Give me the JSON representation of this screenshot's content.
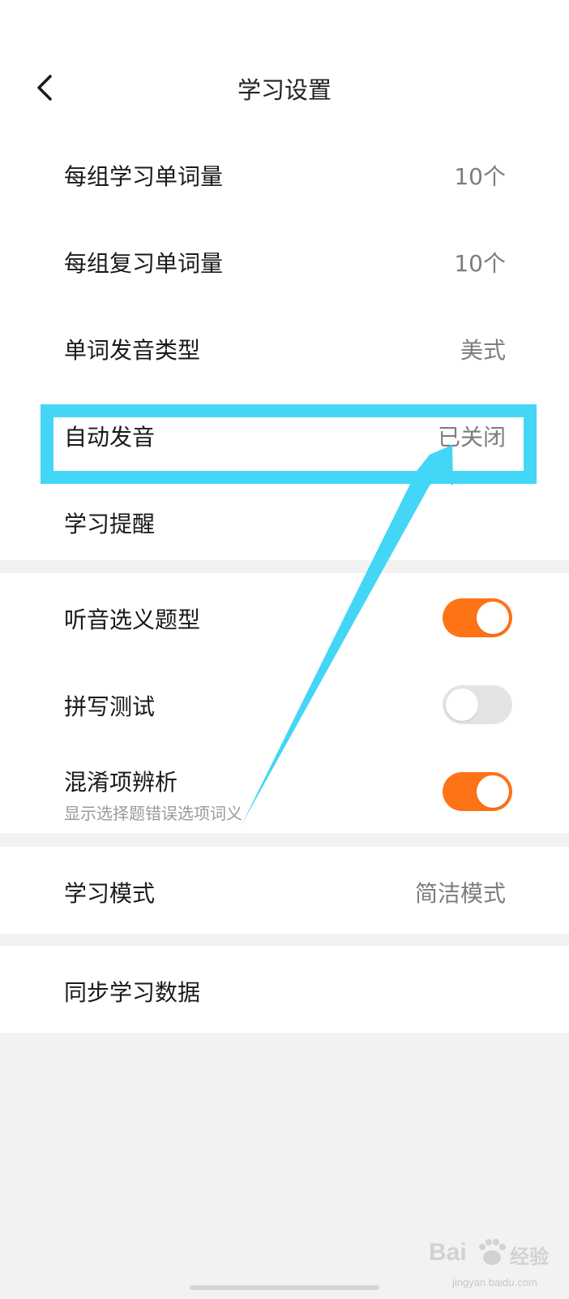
{
  "header": {
    "title": "学习设置",
    "back_icon": "chevron-left-icon"
  },
  "settings_group_1": [
    {
      "label": "每组学习单词量",
      "value": "10个"
    },
    {
      "label": "每组复习单词量",
      "value": "10个"
    },
    {
      "label": "单词发音类型",
      "value": "美式"
    },
    {
      "label": "自动发音",
      "value": "已关闭"
    },
    {
      "label": "学习提醒",
      "value": ""
    }
  ],
  "settings_group_2": [
    {
      "label": "听音选义题型",
      "toggle": "on"
    },
    {
      "label": "拼写测试",
      "toggle": "off"
    },
    {
      "label": "混淆项辨析",
      "sublabel": "显示选择题错误选项词义",
      "toggle": "on"
    }
  ],
  "settings_group_3": {
    "label": "学习模式",
    "value": "简洁模式"
  },
  "settings_group_4": {
    "label": "同步学习数据"
  },
  "annotation": {
    "highlight_color": "#44d6f6",
    "arrow_color": "#44d6f6"
  },
  "colors": {
    "toggle_on": "#ff7317",
    "toggle_off": "#e4e4e4"
  },
  "watermark": {
    "brand": "Bai",
    "brand_suffix": "经验",
    "url": "jingyan.baidu.com"
  }
}
